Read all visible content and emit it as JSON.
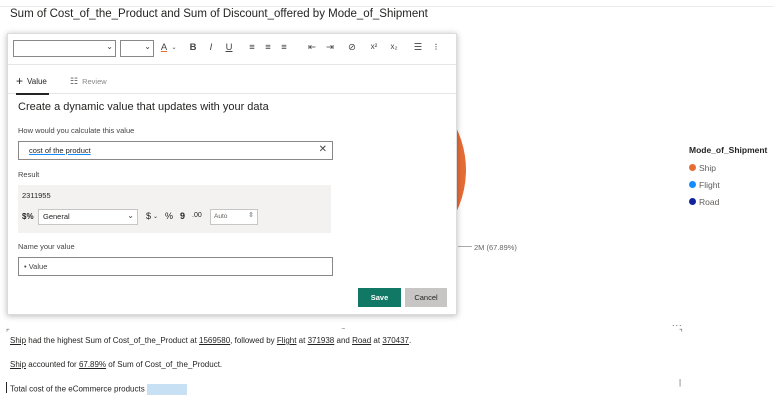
{
  "chart": {
    "title": "Sum of Cost_of_the_Product and Sum of Discount_offered by Mode_of_Shipment",
    "slice_label": "2M (67.89%)",
    "colors": {
      "ship": "#e66c37",
      "flight": "#118dff",
      "road": "#12239e"
    }
  },
  "legend": {
    "title": "Mode_of_Shipment",
    "items": [
      {
        "label": "Ship",
        "color": "#e66c37"
      },
      {
        "label": "Flight",
        "color": "#118dff"
      },
      {
        "label": "Road",
        "color": "#12239e"
      }
    ]
  },
  "chart_data": {
    "type": "pie",
    "title": "Sum of Cost_of_the_Product and Sum of Discount_offered by Mode_of_Shipment",
    "categories": [
      "Ship",
      "Flight",
      "Road"
    ],
    "values": [
      1569580,
      371938,
      370437
    ],
    "data_labels": [
      "2M (67.89%)"
    ],
    "legend_title": "Mode_of_Shipment",
    "legend_position": "right"
  },
  "toolbar": {
    "font_value": "",
    "size_value": "",
    "buttons": [
      {
        "name": "font-color-button",
        "glyph": "A",
        "label": "Font color"
      },
      {
        "name": "bold-button",
        "glyph": "B",
        "label": "Bold"
      },
      {
        "name": "italic-button",
        "glyph": "I",
        "label": "Italic"
      },
      {
        "name": "underline-button",
        "glyph": "U",
        "label": "Underline"
      },
      {
        "name": "align-left-button",
        "glyph": "≡",
        "label": "Align left"
      },
      {
        "name": "align-center-button",
        "glyph": "≡",
        "label": "Align center"
      },
      {
        "name": "align-right-button",
        "glyph": "≡",
        "label": "Align right"
      },
      {
        "name": "indent-decrease-button",
        "glyph": "⇤",
        "label": "Decrease indent"
      },
      {
        "name": "indent-increase-button",
        "glyph": "⇥",
        "label": "Increase indent"
      },
      {
        "name": "link-button",
        "glyph": "⊘",
        "label": "Link"
      },
      {
        "name": "superscript-button",
        "glyph": "x²",
        "label": "Superscript"
      },
      {
        "name": "subscript-button",
        "glyph": "x₂",
        "label": "Subscript"
      },
      {
        "name": "bullet-list-button",
        "glyph": "☰",
        "label": "Bullets"
      },
      {
        "name": "numbered-list-button",
        "glyph": "⁝",
        "label": "Numbering"
      }
    ]
  },
  "tabs": {
    "value": "Value",
    "review": "Review"
  },
  "dialog": {
    "heading": "Create a dynamic value that updates with your data",
    "calc_label": "How would you calculate this value",
    "calc_value": "cost of the product",
    "result_label": "Result",
    "result_value": "2311955",
    "format_value": "General",
    "currency_symbol": "$",
    "percent_symbol": "%",
    "comma_symbol": "9",
    "decimal_symbol": ".00",
    "decimals_value": "Auto",
    "name_label": "Name your value",
    "name_value": "Value",
    "save": "Save",
    "cancel": "Cancel"
  },
  "narrative": {
    "line1_a": "Ship",
    "line1_b": " had the highest Sum of Cost_of_the_Product at ",
    "line1_v1": "1569580",
    "line1_c": ", followed by ",
    "line1_d": "Flight",
    "line1_e": " at ",
    "line1_v2": "371938",
    "line1_f": " and ",
    "line1_g": "Road",
    "line1_h": " at ",
    "line1_v3": "370437",
    "line1_i": ".",
    "line2_a": "Ship",
    "line2_b": " accounted for ",
    "line2_v": "67.89%",
    "line2_c": " of Sum of Cost_of_the_Product.",
    "line3": "Total cost of the eCommerce products",
    "more": "..."
  }
}
